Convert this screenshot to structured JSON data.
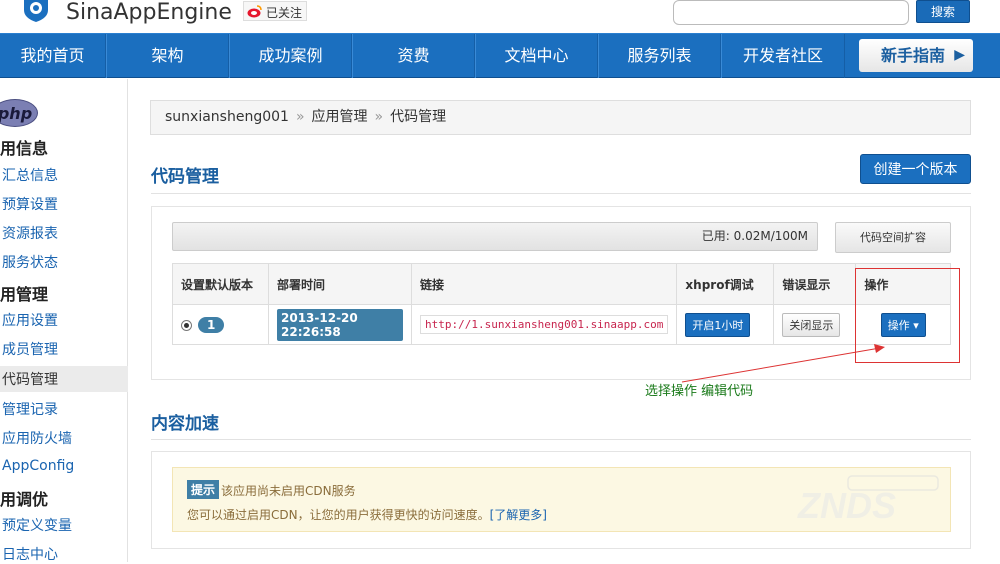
{
  "header": {
    "logo_text": "SinaAppEngine",
    "weibo_follow": "已关注",
    "search_placeholder": "",
    "search_button": "搜索"
  },
  "nav": {
    "items": [
      "我的首页",
      "架构",
      "成功案例",
      "资费",
      "文档中心",
      "服务列表",
      "开发者社区"
    ],
    "guide": "新手指南",
    "guide_arrow": "▶"
  },
  "sidebar": {
    "logo": "php",
    "sections": [
      {
        "heading": "用信息",
        "links": [
          "汇总信息",
          "预算设置",
          "资源报表",
          "服务状态"
        ]
      },
      {
        "heading": "用管理",
        "links": [
          "应用设置",
          "成员管理",
          "代码管理",
          "管理记录",
          "应用防火墙",
          "AppConfig"
        ]
      },
      {
        "heading": "用调优",
        "links": [
          "预定义变量",
          "日志中心"
        ]
      }
    ],
    "active": "代码管理"
  },
  "breadcrumb": [
    "sunxiansheng001",
    "应用管理",
    "代码管理"
  ],
  "breadcrumb_sep": "»",
  "code_section": {
    "title": "代码管理",
    "create_button": "创建一个版本",
    "usage_text": "已用: 0.02M/100M",
    "expand_button": "代码空间扩容",
    "table": {
      "headers": [
        "设置默认版本",
        "部署时间",
        "链接",
        "xhprof调试",
        "错误显示",
        "操作"
      ],
      "rows": [
        {
          "version": "1",
          "time": "2013-12-20 22:26:58",
          "url": "http://1.sunxiansheng001.sinaapp.com",
          "xhprof": "开启1小时",
          "error": "关闭显示",
          "action": "操作"
        }
      ]
    }
  },
  "annotation": "选择操作  编辑代码",
  "cdn_section": {
    "title": "内容加速",
    "tip_label": "提示",
    "tip_text": "该应用尚未启用CDN服务",
    "tip_text2": "您可以通过启用CDN，让您的用户获得更快的访问速度。",
    "learn_more": "[了解更多]"
  },
  "watermark": "ZNDS",
  "colors": {
    "nav_blue": "#1b6fbf",
    "annotation_red": "#dd3333",
    "annotation_green": "#1a7a1a"
  }
}
